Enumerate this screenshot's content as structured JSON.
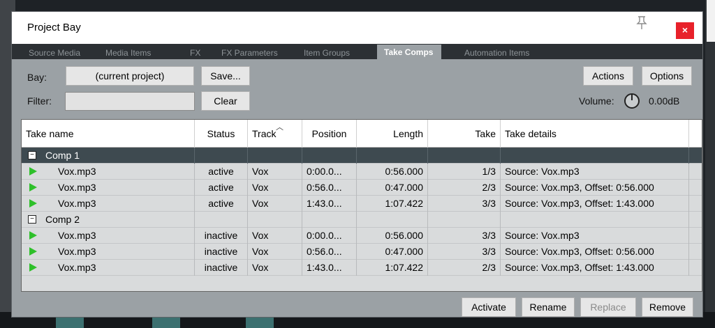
{
  "window": {
    "title": "Project Bay",
    "pin_icon": "pin-icon",
    "close_label": "×",
    "close_color": "#e8212a"
  },
  "tabs": [
    {
      "label": "Source Media",
      "active": false
    },
    {
      "label": "Media Items",
      "active": false
    },
    {
      "label": "FX",
      "active": false
    },
    {
      "label": "FX Parameters",
      "active": false
    },
    {
      "label": "Item Groups",
      "active": false
    },
    {
      "label": "Take Comps",
      "active": true
    },
    {
      "label": "Automation Items",
      "active": false
    }
  ],
  "toolbar": {
    "bay_label": "Bay:",
    "bay_value": "(current project)",
    "save_label": "Save...",
    "filter_label": "Filter:",
    "filter_value": "",
    "clear_label": "Clear",
    "actions_label": "Actions",
    "options_label": "Options",
    "volume_label": "Volume:",
    "volume_value": "0.00dB"
  },
  "table": {
    "columns": [
      "Take name",
      "Status",
      "Track",
      "Position",
      "Length",
      "Take",
      "Take details"
    ],
    "groups": [
      {
        "name": "Comp 1",
        "expander": "−",
        "selected": true,
        "rows": [
          {
            "name": "Vox.mp3",
            "status": "active",
            "track": "Vox",
            "position": "0:00.0...",
            "length": "0:56.000",
            "take": "1/3",
            "details": "Source: Vox.mp3"
          },
          {
            "name": "Vox.mp3",
            "status": "active",
            "track": "Vox",
            "position": "0:56.0...",
            "length": "0:47.000",
            "take": "2/3",
            "details": "Source: Vox.mp3, Offset: 0:56.000"
          },
          {
            "name": "Vox.mp3",
            "status": "active",
            "track": "Vox",
            "position": "1:43.0...",
            "length": "1:07.422",
            "take": "3/3",
            "details": "Source: Vox.mp3, Offset: 1:43.000"
          }
        ]
      },
      {
        "name": "Comp 2",
        "expander": "−",
        "selected": false,
        "rows": [
          {
            "name": "Vox.mp3",
            "status": "inactive",
            "track": "Vox",
            "position": "0:00.0...",
            "length": "0:56.000",
            "take": "3/3",
            "details": "Source: Vox.mp3"
          },
          {
            "name": "Vox.mp3",
            "status": "inactive",
            "track": "Vox",
            "position": "0:56.0...",
            "length": "0:47.000",
            "take": "3/3",
            "details": "Source: Vox.mp3, Offset: 0:56.000"
          },
          {
            "name": "Vox.mp3",
            "status": "inactive",
            "track": "Vox",
            "position": "1:43.0...",
            "length": "1:07.422",
            "take": "2/3",
            "details": "Source: Vox.mp3, Offset: 1:43.000"
          }
        ]
      }
    ]
  },
  "footer": {
    "activate_label": "Activate",
    "rename_label": "Rename",
    "replace_label": "Replace",
    "remove_label": "Remove"
  },
  "colors": {
    "selected_row": "#3e4a50",
    "play_icon": "#2ec02a",
    "panel_bg": "#9ba1a5"
  }
}
